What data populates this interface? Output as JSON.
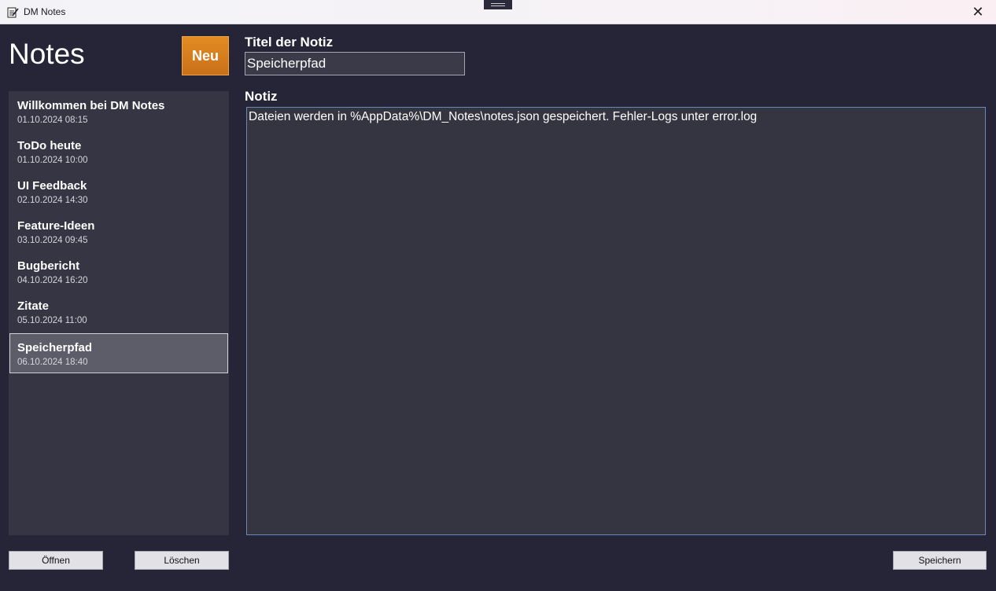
{
  "window": {
    "title": "DM Notes"
  },
  "header": {
    "heading": "Notes",
    "new_button": "Neu"
  },
  "notes": [
    {
      "title": "Willkommen bei DM Notes",
      "date": "01.10.2024 08:15"
    },
    {
      "title": "ToDo heute",
      "date": "01.10.2024 10:00"
    },
    {
      "title": "UI Feedback",
      "date": "02.10.2024 14:30"
    },
    {
      "title": "Feature-Ideen",
      "date": "03.10.2024 09:45"
    },
    {
      "title": "Bugbericht",
      "date": "04.10.2024 16:20"
    },
    {
      "title": "Zitate",
      "date": "05.10.2024 11:00"
    },
    {
      "title": "Speicherpfad",
      "date": "06.10.2024 18:40",
      "selected": true
    }
  ],
  "editor": {
    "title_label": "Titel der Notiz",
    "title_value": "Speicherpfad",
    "note_label": "Notiz",
    "note_value": "Dateien werden in %AppData%\\DM_Notes\\notes.json gespeichert. Fehler-Logs unter error.log"
  },
  "buttons": {
    "open": "Öffnen",
    "delete": "Löschen",
    "save": "Speichern"
  },
  "colors": {
    "accent": "#d97d1f",
    "background": "#262537",
    "panel": "#363543",
    "selected": "#5d5c69",
    "focus_border": "#6b88bb"
  }
}
